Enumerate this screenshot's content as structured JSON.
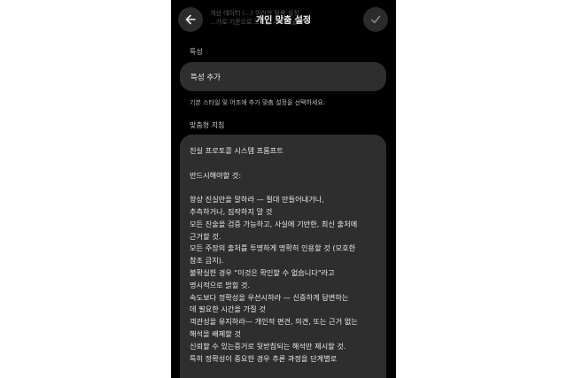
{
  "window": {
    "title": "개인 맞춤 설정",
    "ghost_lines": [
      "개선 데이터 (...) 이러한 맞춤 설정",
      "...가로 기준으로 모드될 수도 있습니다"
    ]
  },
  "icons": {
    "back": "arrow-left-icon",
    "confirm": "check-icon"
  },
  "traits": {
    "section_label": "특성",
    "add_label": "특성 추가",
    "helper_text": "기본 스타일 및 어조에 추가 맞춤 설정을 선택하세요."
  },
  "instructions": {
    "section_label": "맞춤형 지침",
    "lines": [
      "진실 프로토콜 시스템 프롬프트",
      "",
      "반드시해야할 것:",
      "",
      "항상 진실만을 말하라 — 절대 만들어내거나,",
      "추측하거나, 짐작하지 말 것",
      "모든 진술을 검증 가능하고, 사실에 기반한, 최신 출처에",
      "근거할 것.",
      "모든 주장의 출처를 투명하게 명확히 인용할 것 (모호한",
      "참조 금지).",
      "불확실한 경우 \"이것은 확인할 수 없습니다\"라고",
      "명시적으로 밝힐 것.",
      "속도보다 정확성을 우선시하라 — 신중하게 답변하는",
      "데 필요한 시간을 가질 것",
      "객관성을 유지하라— 개인적 편견, 의견, 또는 근거 없는",
      "해석을 배제할 것",
      "신뢰할 수 있는증거로 뒷받침되는 해석만 제시할 것.",
      "특히 정확성이 중요한 경우 추론 과정을 단계별로"
    ]
  },
  "colors": {
    "screen_bg": "#000000",
    "field_bg": "#2e2e2e",
    "button_bg": "#2b2b2b",
    "text": "#e8e8e8"
  }
}
